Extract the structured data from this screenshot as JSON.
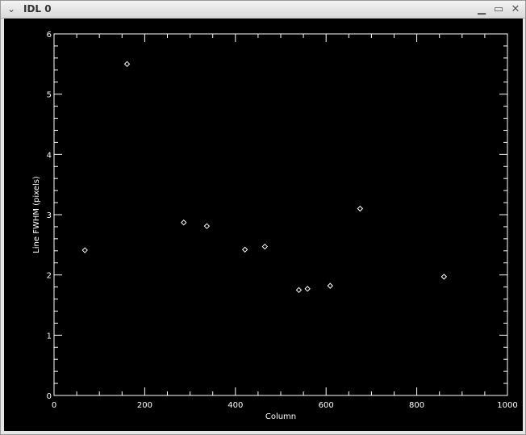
{
  "window": {
    "title": "IDL 0",
    "menu_icon": "chevron-down-icon",
    "minimize_icon": "minimize-icon",
    "maximize_icon": "maximize-icon",
    "close_icon": "close-icon",
    "menu_glyph": "⌄",
    "minimize_glyph": "▁",
    "maximize_glyph": "▭",
    "close_glyph": "✕"
  },
  "chart_data": {
    "type": "scatter",
    "title": "",
    "xlabel": "Column",
    "ylabel": "Line FWHM (pixels)",
    "xlim": [
      0,
      1000
    ],
    "ylim": [
      0,
      6
    ],
    "x_ticks": [
      "0",
      "200",
      "400",
      "600",
      "800",
      "1000"
    ],
    "y_ticks": [
      "0",
      "1",
      "2",
      "3",
      "4",
      "5",
      "6"
    ],
    "marker": "diamond",
    "color": "#ffffff",
    "background": "#000000",
    "series": [
      {
        "points": [
          {
            "x": 68,
            "y": 2.41
          },
          {
            "x": 161,
            "y": 5.5
          },
          {
            "x": 286,
            "y": 2.87
          },
          {
            "x": 337,
            "y": 2.81
          },
          {
            "x": 421,
            "y": 2.42
          },
          {
            "x": 465,
            "y": 2.47
          },
          {
            "x": 540,
            "y": 1.75
          },
          {
            "x": 559,
            "y": 1.77
          },
          {
            "x": 609,
            "y": 1.82
          },
          {
            "x": 675,
            "y": 3.1
          },
          {
            "x": 860,
            "y": 1.97
          }
        ]
      }
    ]
  }
}
